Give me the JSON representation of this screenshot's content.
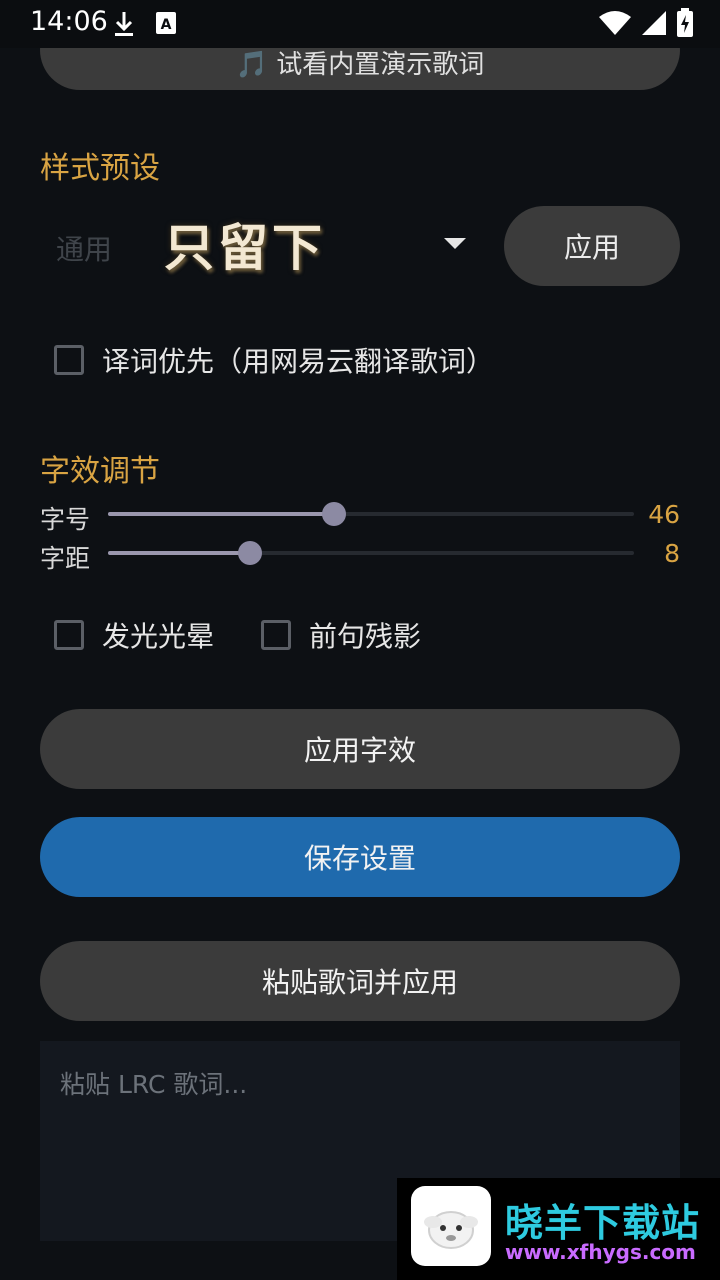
{
  "status_bar": {
    "time": "14:06",
    "icons_left": [
      "download-icon",
      "keyboard-a-icon"
    ],
    "icons_right": [
      "wifi-icon",
      "signal-icon",
      "battery-charging-icon"
    ]
  },
  "top_button": {
    "label": "🎵 试看内置演示歌词"
  },
  "style_preset": {
    "title": "样式预设",
    "hint": "通用",
    "preview_text": "只留下",
    "apply_label": "应用"
  },
  "translation_pref": {
    "label": "译词优先（用网易云翻译歌词）",
    "checked": false
  },
  "text_effects": {
    "title": "字效调节",
    "font_size": {
      "label": "字号",
      "value": "46",
      "fraction": 0.43
    },
    "spacing": {
      "label": "字距",
      "value": "8",
      "fraction": 0.27
    },
    "glow": {
      "label": "发光光晕",
      "checked": false
    },
    "afterimage": {
      "label": "前句残影",
      "checked": false
    }
  },
  "buttons": {
    "apply_effects": "应用字效",
    "save_settings": "保存设置",
    "paste_apply": "粘贴歌词并应用"
  },
  "lrc_input": {
    "placeholder": "粘贴 LRC 歌词..."
  },
  "watermark": {
    "title": "晓羊下载站",
    "url": "www.xfhygs.com"
  },
  "colors": {
    "accent": "#d9a443",
    "primary_button": "#1f6aad",
    "secondary_button": "#3b3b3b",
    "background": "#0d1014"
  }
}
